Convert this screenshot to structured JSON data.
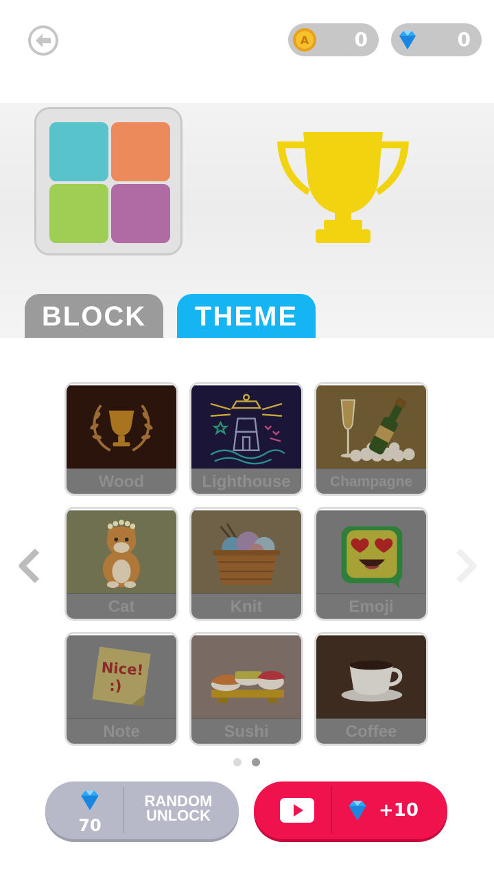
{
  "header": {
    "coins": "0",
    "gems": "0"
  },
  "preview": {
    "tile_colors": [
      "#59c3cc",
      "#ec8a5b",
      "#9ecf54",
      "#b06ba5"
    ],
    "trophy_color": "#f2d30f"
  },
  "tabs": [
    {
      "label": "BLOCK",
      "active": false
    },
    {
      "label": "THEME",
      "active": true
    }
  ],
  "themes": [
    {
      "label": "Wood",
      "icon": "laurel-trophy-icon"
    },
    {
      "label": "Lighthouse",
      "icon": "lighthouse-icon"
    },
    {
      "label": "Champagne",
      "icon": "champagne-icon"
    },
    {
      "label": "Cat",
      "icon": "cat-icon"
    },
    {
      "label": "Knit",
      "icon": "yarn-basket-icon"
    },
    {
      "label": "Emoji",
      "icon": "heart-eyes-emoji-icon"
    },
    {
      "label": "Note",
      "icon": "sticky-note-icon",
      "note_text": "Nice!\n:)"
    },
    {
      "label": "Sushi",
      "icon": "sushi-icon"
    },
    {
      "label": "Coffee",
      "icon": "coffee-cup-icon"
    }
  ],
  "pager": {
    "pages": 2,
    "current": 2
  },
  "random_unlock": {
    "cost": "70",
    "label_line1": "RANDOM",
    "label_line2": "UNLOCK"
  },
  "video_reward": {
    "reward": "+10"
  },
  "colors": {
    "accent_blue": "#14b5f2",
    "video_red": "#f0124c",
    "gray_tab": "#9b9b9b"
  }
}
